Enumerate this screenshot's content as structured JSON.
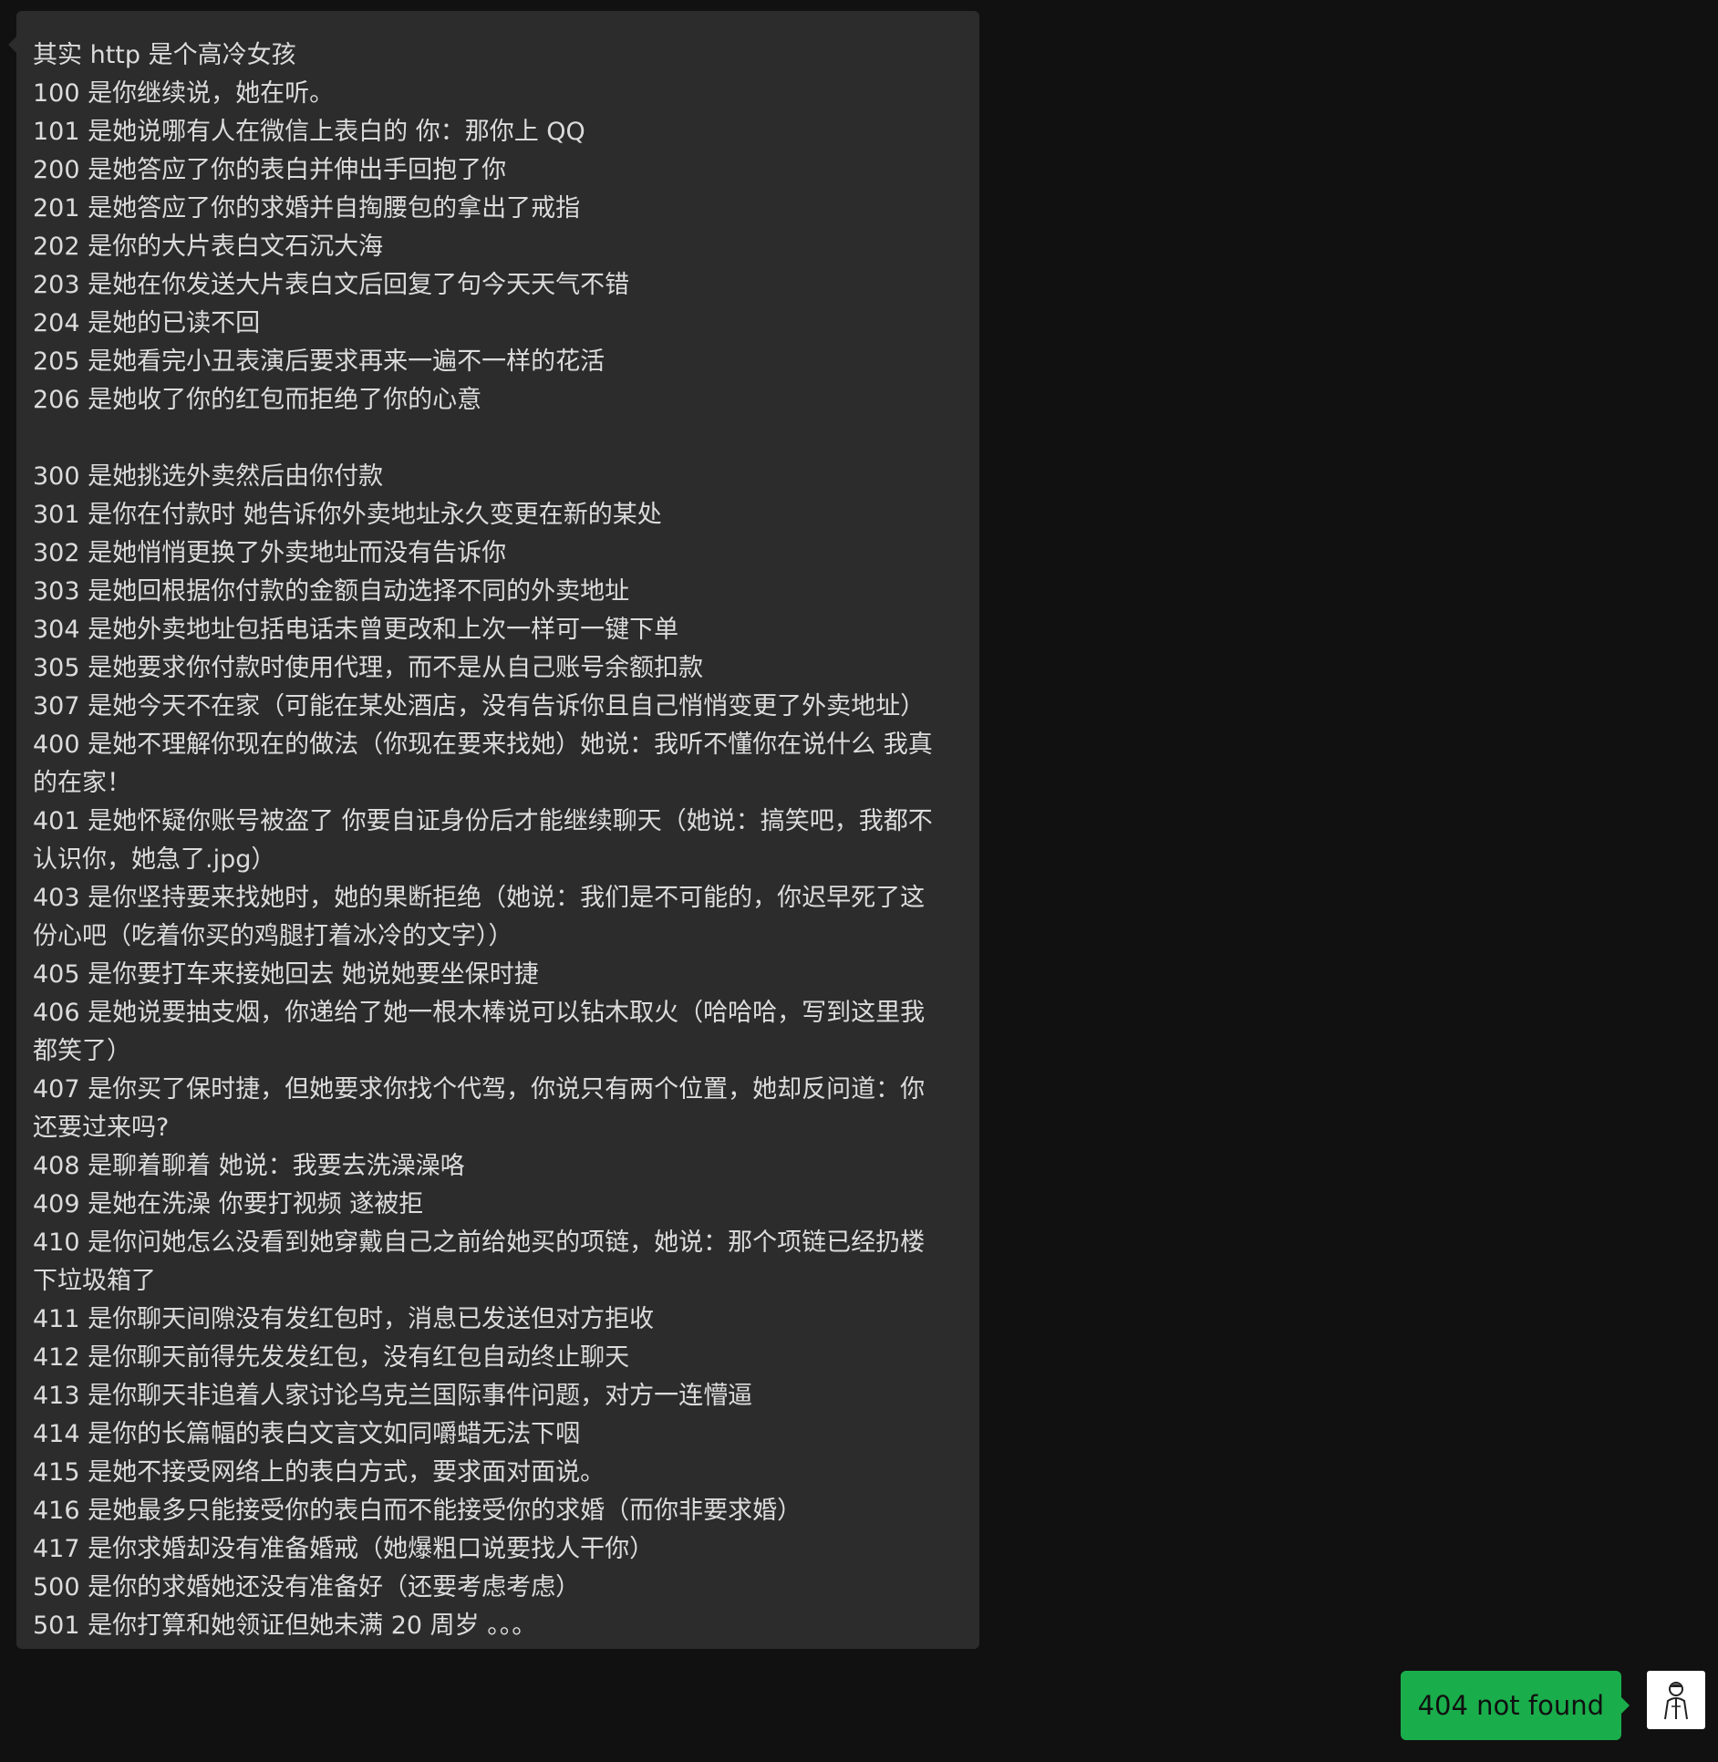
{
  "incoming_message": {
    "lines": [
      "其实 http 是个高冷女孩",
      "100 是你继续说，她在听。",
      "101 是她说哪有人在微信上表白的 你：那你上 QQ",
      "200 是她答应了你的表白并伸出手回抱了你",
      "201 是她答应了你的求婚并自掏腰包的拿出了戒指",
      "202 是你的大片表白文石沉大海",
      "203 是她在你发送大片表白文后回复了句今天天气不错",
      "204 是她的已读不回",
      "205 是她看完小丑表演后要求再来一遍不一样的花活",
      "206 是她收了你的红包而拒绝了你的心意",
      "",
      "300 是她挑选外卖然后由你付款",
      "301 是你在付款时 她告诉你外卖地址永久变更在新的某处",
      "302 是她悄悄更换了外卖地址而没有告诉你",
      "303 是她回根据你付款的金额自动选择不同的外卖地址",
      "304 是她外卖地址包括电话未曾更改和上次一样可一键下单",
      "305 是她要求你付款时使用代理，而不是从自己账号余额扣款",
      "307 是她今天不在家（可能在某处酒店，没有告诉你且自己悄悄变更了外卖地址）",
      "400 是她不理解你现在的做法（你现在要来找她）她说：我听不懂你在说什么 我真",
      "的在家！",
      "401 是她怀疑你账号被盗了 你要自证身份后才能继续聊天（她说：搞笑吧，我都不",
      "认识你，她急了.jpg）",
      "403 是你坚持要来找她时，她的果断拒绝（她说：我们是不可能的，你迟早死了这",
      "份心吧（吃着你买的鸡腿打着冰冷的文字））",
      "405 是你要打车来接她回去 她说她要坐保时捷",
      "406 是她说要抽支烟，你递给了她一根木棒说可以钻木取火（哈哈哈，写到这里我",
      "都笑了）",
      "407 是你买了保时捷，但她要求你找个代驾，你说只有两个位置，她却反问道：你",
      "还要过来吗?",
      "408 是聊着聊着 她说：我要去洗澡澡咯",
      "409 是她在洗澡 你要打视频 遂被拒",
      "410 是你问她怎么没看到她穿戴自己之前给她买的项链，她说：那个项链已经扔楼",
      "下垃圾箱了",
      "411 是你聊天间隙没有发红包时，消息已发送但对方拒收",
      "412 是你聊天前得先发发红包，没有红包自动终止聊天",
      "413 是你聊天非追着人家讨论乌克兰国际事件问题，对方一连懵逼",
      "414 是你的长篇幅的表白文言文如同嚼蜡无法下咽",
      "415 是她不接受网络上的表白方式，要求面对面说。",
      "416 是她最多只能接受你的表白而不能接受你的求婚（而你非要求婚）",
      "417 是你求婚却没有准备婚戒（她爆粗口说要找人干你）",
      "500 是你的求婚她还没有准备好（还要考虑考虑）",
      "501 是你打算和她领证但她未满 20 周岁 。。。"
    ]
  },
  "outgoing_message": {
    "text": "404 not found"
  },
  "colors": {
    "background": "#111111",
    "incoming_bubble": "#2c2c2c",
    "incoming_text": "#dcdcdc",
    "outgoing_bubble": "#1aad4b",
    "outgoing_text": "#101010"
  },
  "icons": {
    "avatar": "user-avatar-icon"
  }
}
